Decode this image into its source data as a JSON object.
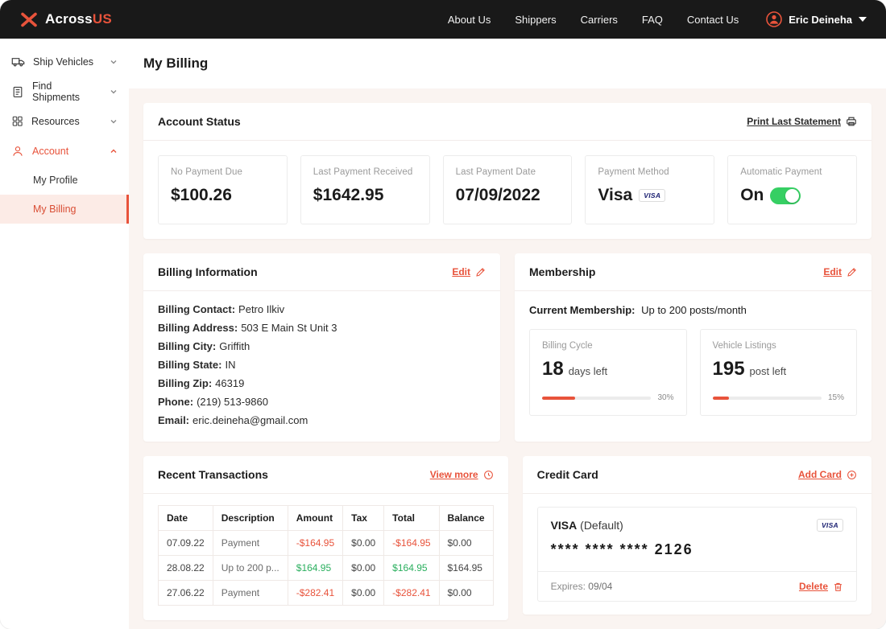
{
  "brand": {
    "name_primary": "Across",
    "name_secondary": "US"
  },
  "navbar": {
    "links": [
      {
        "label": "About Us"
      },
      {
        "label": "Shippers"
      },
      {
        "label": "Carriers"
      },
      {
        "label": "FAQ"
      },
      {
        "label": "Contact Us"
      }
    ],
    "user": {
      "name": "Eric Deineha"
    }
  },
  "sidebar": {
    "items": [
      {
        "label": "Ship Vehicles"
      },
      {
        "label": "Find Shipments"
      },
      {
        "label": "Resources"
      },
      {
        "label": "Account"
      }
    ],
    "account_children": [
      {
        "label": "My Profile"
      },
      {
        "label": "My Billing"
      }
    ]
  },
  "page": {
    "title": "My Billing"
  },
  "account_status": {
    "title": "Account Status",
    "print_link": "Print Last Statement",
    "visa_badge": "VISA",
    "stats": [
      {
        "label": "No Payment Due",
        "value": "$100.26"
      },
      {
        "label": "Last Payment Received",
        "value": "$1642.95"
      },
      {
        "label": "Last Payment Date",
        "value": "07/09/2022"
      },
      {
        "label": "Payment Method",
        "value": "Visa"
      },
      {
        "label": "Automatic Payment",
        "value": "On"
      }
    ]
  },
  "billing_info": {
    "title": "Billing Information",
    "edit_label": "Edit",
    "fields": [
      {
        "label": "Billing Contact:",
        "value": "Petro Ilkiv"
      },
      {
        "label": "Billing Address:",
        "value": "503 E Main St Unit 3"
      },
      {
        "label": "Billing City:",
        "value": "Griffith"
      },
      {
        "label": "Billing State:",
        "value": "IN"
      },
      {
        "label": "Billing Zip:",
        "value": "46319"
      },
      {
        "label": "Phone:",
        "value": "(219) 513-9860"
      },
      {
        "label": "Email:",
        "value": "eric.deineha@gmail.com"
      }
    ]
  },
  "membership": {
    "title": "Membership",
    "edit_label": "Edit",
    "current_label": "Current Membership:",
    "current_value": "Up to 200 posts/month",
    "meters": [
      {
        "label": "Billing Cycle",
        "value": "18",
        "unit": "days left",
        "percent": "30%"
      },
      {
        "label": "Vehicle Listings",
        "value": "195",
        "unit": "post left",
        "percent": "15%"
      }
    ]
  },
  "transactions": {
    "title": "Recent Transactions",
    "view_more": "View more",
    "columns": [
      "Date",
      "Description",
      "Amount",
      "Tax",
      "Total",
      "Balance"
    ],
    "rows": [
      {
        "date": "07.09.22",
        "description": "Payment",
        "amount": "-$164.95",
        "tax": "$0.00",
        "total": "-$164.95",
        "balance": "$0.00"
      },
      {
        "date": "28.08.22",
        "description": "Up to 200 p...",
        "amount": "$164.95",
        "tax": "$0.00",
        "total": "$164.95",
        "balance": "$164.95"
      },
      {
        "date": "27.06.22",
        "description": "Payment",
        "amount": "-$282.41",
        "tax": "$0.00",
        "total": "-$282.41",
        "balance": "$0.00"
      }
    ]
  },
  "credit_card": {
    "title": "Credit Card",
    "add_label": "Add Card",
    "card_name": "VISA",
    "card_default": "(Default)",
    "visa_badge": "VISA",
    "card_number": "**** **** **** 2126",
    "expires_label": "Expires:",
    "expires_value": "09/04",
    "delete_label": "Delete"
  },
  "colors": {
    "accent": "#e8533b",
    "positive": "#2aaf5e",
    "toggle_on": "#36cf63",
    "navbar_bg": "#191919",
    "content_bg": "#faf4f1"
  }
}
